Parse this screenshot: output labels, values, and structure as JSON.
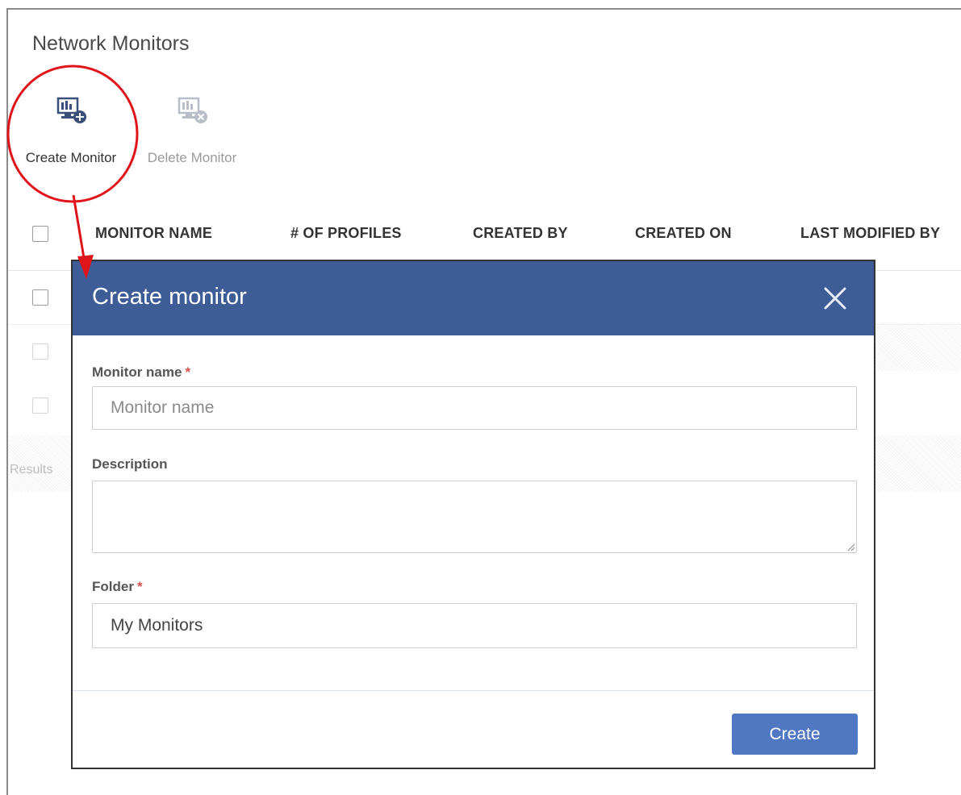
{
  "page": {
    "title": "Network Monitors"
  },
  "toolbar": {
    "create_label": "Create Monitor",
    "delete_label": "Delete Monitor",
    "create_icon": "monitor-add-icon",
    "delete_icon": "monitor-delete-icon"
  },
  "table": {
    "columns": [
      "MONITOR NAME",
      "# OF PROFILES",
      "CREATED BY",
      "CREATED ON",
      "LAST MODIFIED BY"
    ],
    "results_text": "Results"
  },
  "modal": {
    "title": "Create monitor",
    "close_icon": "close-icon",
    "fields": {
      "monitor_name": {
        "label": "Monitor name",
        "required": "*",
        "placeholder": "Monitor name",
        "value": ""
      },
      "description": {
        "label": "Description",
        "value": ""
      },
      "folder": {
        "label": "Folder",
        "required": "*",
        "value": "My Monitors"
      }
    },
    "create_button": "Create"
  },
  "colors": {
    "modal_header": "#3e5c96",
    "primary_button": "#5077c2",
    "annotation": "#e0151b",
    "required": "#d9534f"
  }
}
